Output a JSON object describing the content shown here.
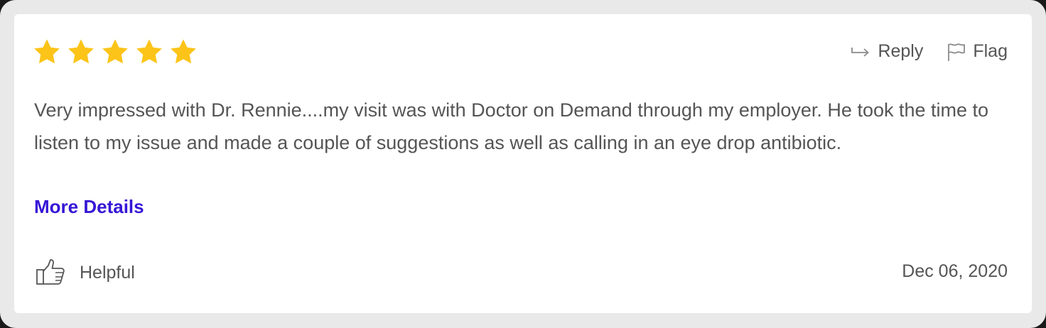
{
  "review": {
    "rating": 5,
    "max_rating": 5,
    "star_color": "#fcc419",
    "text": "Very impressed with Dr. Rennie....my visit was with Doctor on Demand through my employer. He took the time to listen to my issue and made a couple of suggestions as well as calling in an eye drop antibiotic.",
    "more_details_label": "More Details",
    "link_color": "#3716d6",
    "date": "Dec 06, 2020"
  },
  "actions": {
    "reply_label": "Reply",
    "reply_icon": "reply-arrow-icon",
    "flag_label": "Flag",
    "flag_icon": "flag-icon"
  },
  "footer": {
    "helpful_label": "Helpful",
    "helpful_icon": "thumbs-up-icon"
  }
}
